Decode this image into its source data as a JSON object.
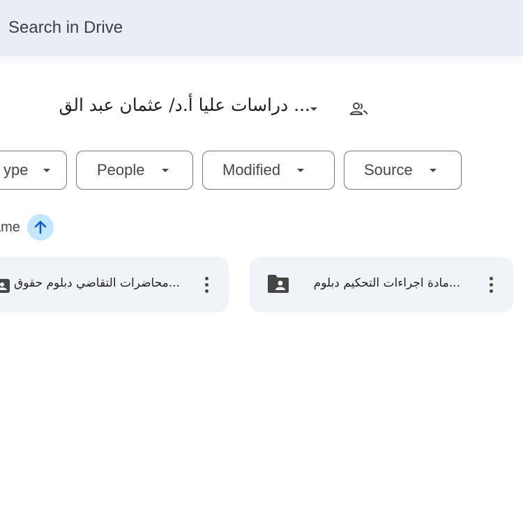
{
  "search": {
    "placeholder": "Search in Drive"
  },
  "breadcrumb": {
    "title": "عثمان عبد القادر ... دراسات عليا أ.د/",
    "title_visible": "... دراسات عليا أ.د/ عثمان عبد الق"
  },
  "filters": [
    {
      "label": "Type",
      "label_visible": "ype"
    },
    {
      "label": "People"
    },
    {
      "label": "Modified"
    },
    {
      "label": "Source"
    }
  ],
  "sort": {
    "label": "Name",
    "label_visible": "ame",
    "direction": "ascending"
  },
  "items": [
    {
      "name": "...محاضرات التقاضي دبلوم حقوق",
      "icon": "shared-folder-icon"
    },
    {
      "name": "...مادة اجراءات التحكيم دبلوم",
      "icon": "shared-folder-icon"
    }
  ],
  "colors": {
    "search_bg": "#e9eef6",
    "card_bg": "#f0f4f9",
    "sort_accent": "#c2e7ff",
    "sort_arrow": "#0b57d0"
  }
}
